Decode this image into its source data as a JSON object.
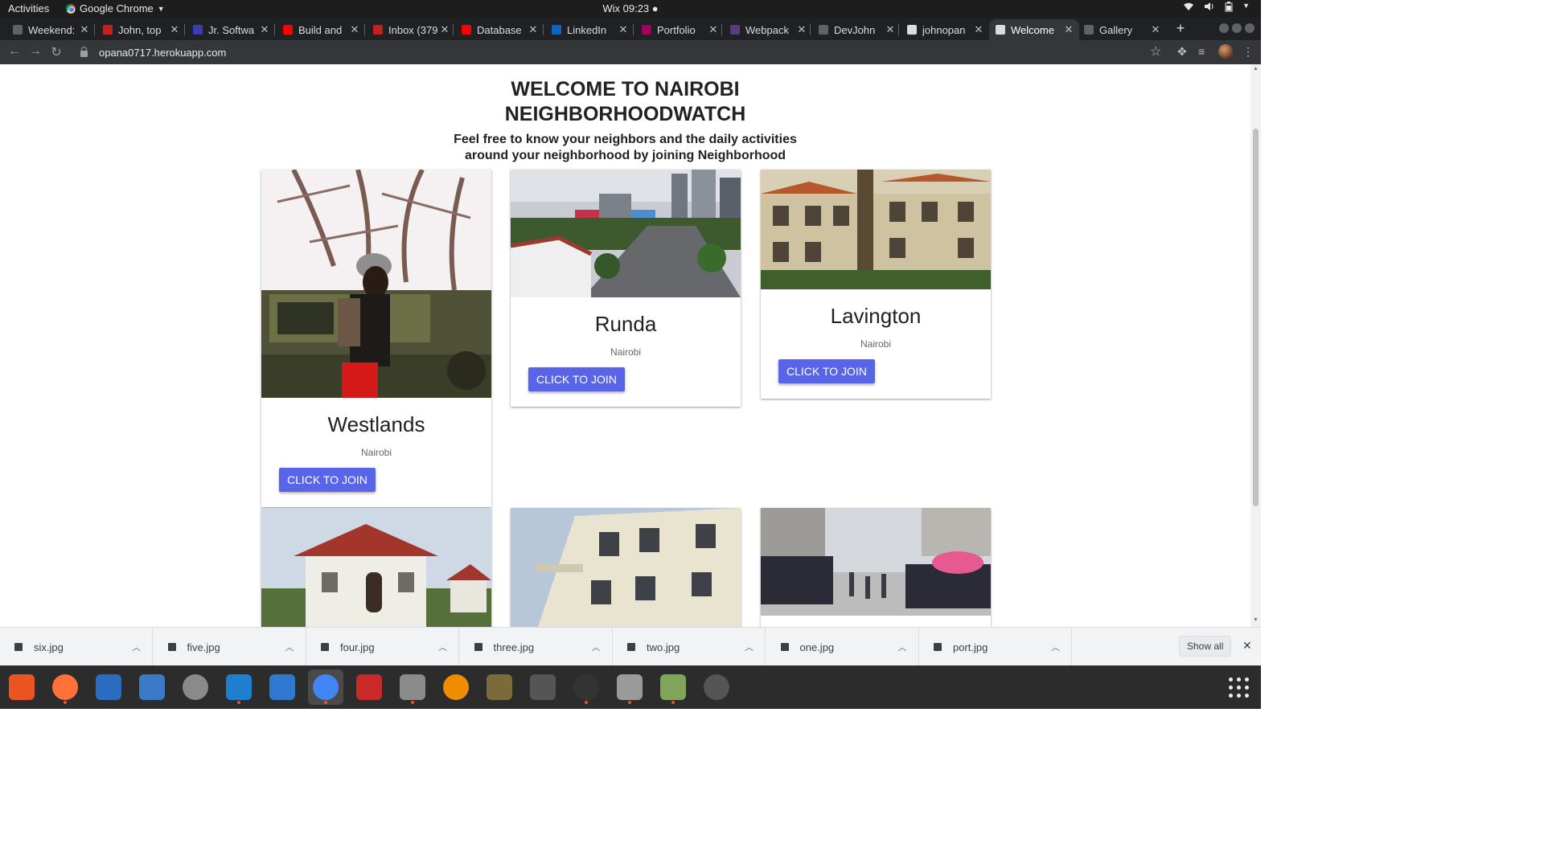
{
  "os": {
    "activities": "Activities",
    "app_name": "Google Chrome",
    "clock": "Wix 09:23 ●"
  },
  "tabs": [
    {
      "title": "Weekend:",
      "favicon_color": "#5f6368"
    },
    {
      "title": "John, top",
      "favicon_color": "#c5221f"
    },
    {
      "title": "Jr. Softwa",
      "favicon_color": "#3c3bb8"
    },
    {
      "title": "Build and",
      "favicon_color": "#ff0000"
    },
    {
      "title": "Inbox (379",
      "favicon_color": "#c5221f"
    },
    {
      "title": "Database",
      "favicon_color": "#ff0000"
    },
    {
      "title": "LinkedIn",
      "favicon_color": "#0a66c2"
    },
    {
      "title": "Portfolio",
      "favicon_color": "#a1005d"
    },
    {
      "title": "Webpack",
      "favicon_color": "#563d7c"
    },
    {
      "title": "DevJohn",
      "favicon_color": "#5f6368"
    },
    {
      "title": "johnopan",
      "favicon_color": "#dadce0"
    },
    {
      "title": "Welcome",
      "favicon_color": "#dadce0",
      "active": true
    },
    {
      "title": "Gallery",
      "favicon_color": "#5f6368"
    }
  ],
  "address_bar": {
    "url": "opana0717.herokuapp.com"
  },
  "page": {
    "heading_line1": "WELCOME TO NAIROBI",
    "heading_line2": "NEIGHBORHOODWATCH",
    "sub_line1": "Feel free to know your neighbors and the daily activities",
    "sub_line2": "around your neighborhood by joining Neighborhood",
    "cards": [
      {
        "name": "Westlands",
        "city": "Nairobi",
        "button": "CLICK TO JOIN"
      },
      {
        "name": "Runda",
        "city": "Nairobi",
        "button": "CLICK TO JOIN"
      },
      {
        "name": "Lavington",
        "city": "Nairobi",
        "button": "CLICK TO JOIN"
      }
    ]
  },
  "downloads": [
    {
      "file": "six.jpg"
    },
    {
      "file": "five.jpg"
    },
    {
      "file": "four.jpg"
    },
    {
      "file": "three.jpg"
    },
    {
      "file": "two.jpg"
    },
    {
      "file": "one.jpg"
    },
    {
      "file": "port.jpg"
    }
  ],
  "show_all_label": "Show all",
  "dock_apps": [
    {
      "icon": "software-center-icon"
    },
    {
      "icon": "firefox-icon"
    },
    {
      "icon": "writer-icon"
    },
    {
      "icon": "help-icon"
    },
    {
      "icon": "printer-icon"
    },
    {
      "icon": "vscode-icon"
    },
    {
      "icon": "thunderbird-icon"
    },
    {
      "icon": "chrome-icon"
    },
    {
      "icon": "pdf-viewer-icon"
    },
    {
      "icon": "files-icon"
    },
    {
      "icon": "vlc-icon"
    },
    {
      "icon": "audio-icon"
    },
    {
      "icon": "video-editor-icon"
    },
    {
      "icon": "terminal-icon"
    },
    {
      "icon": "settings-icon"
    },
    {
      "icon": "image-viewer-icon"
    },
    {
      "icon": "updater-icon"
    }
  ]
}
